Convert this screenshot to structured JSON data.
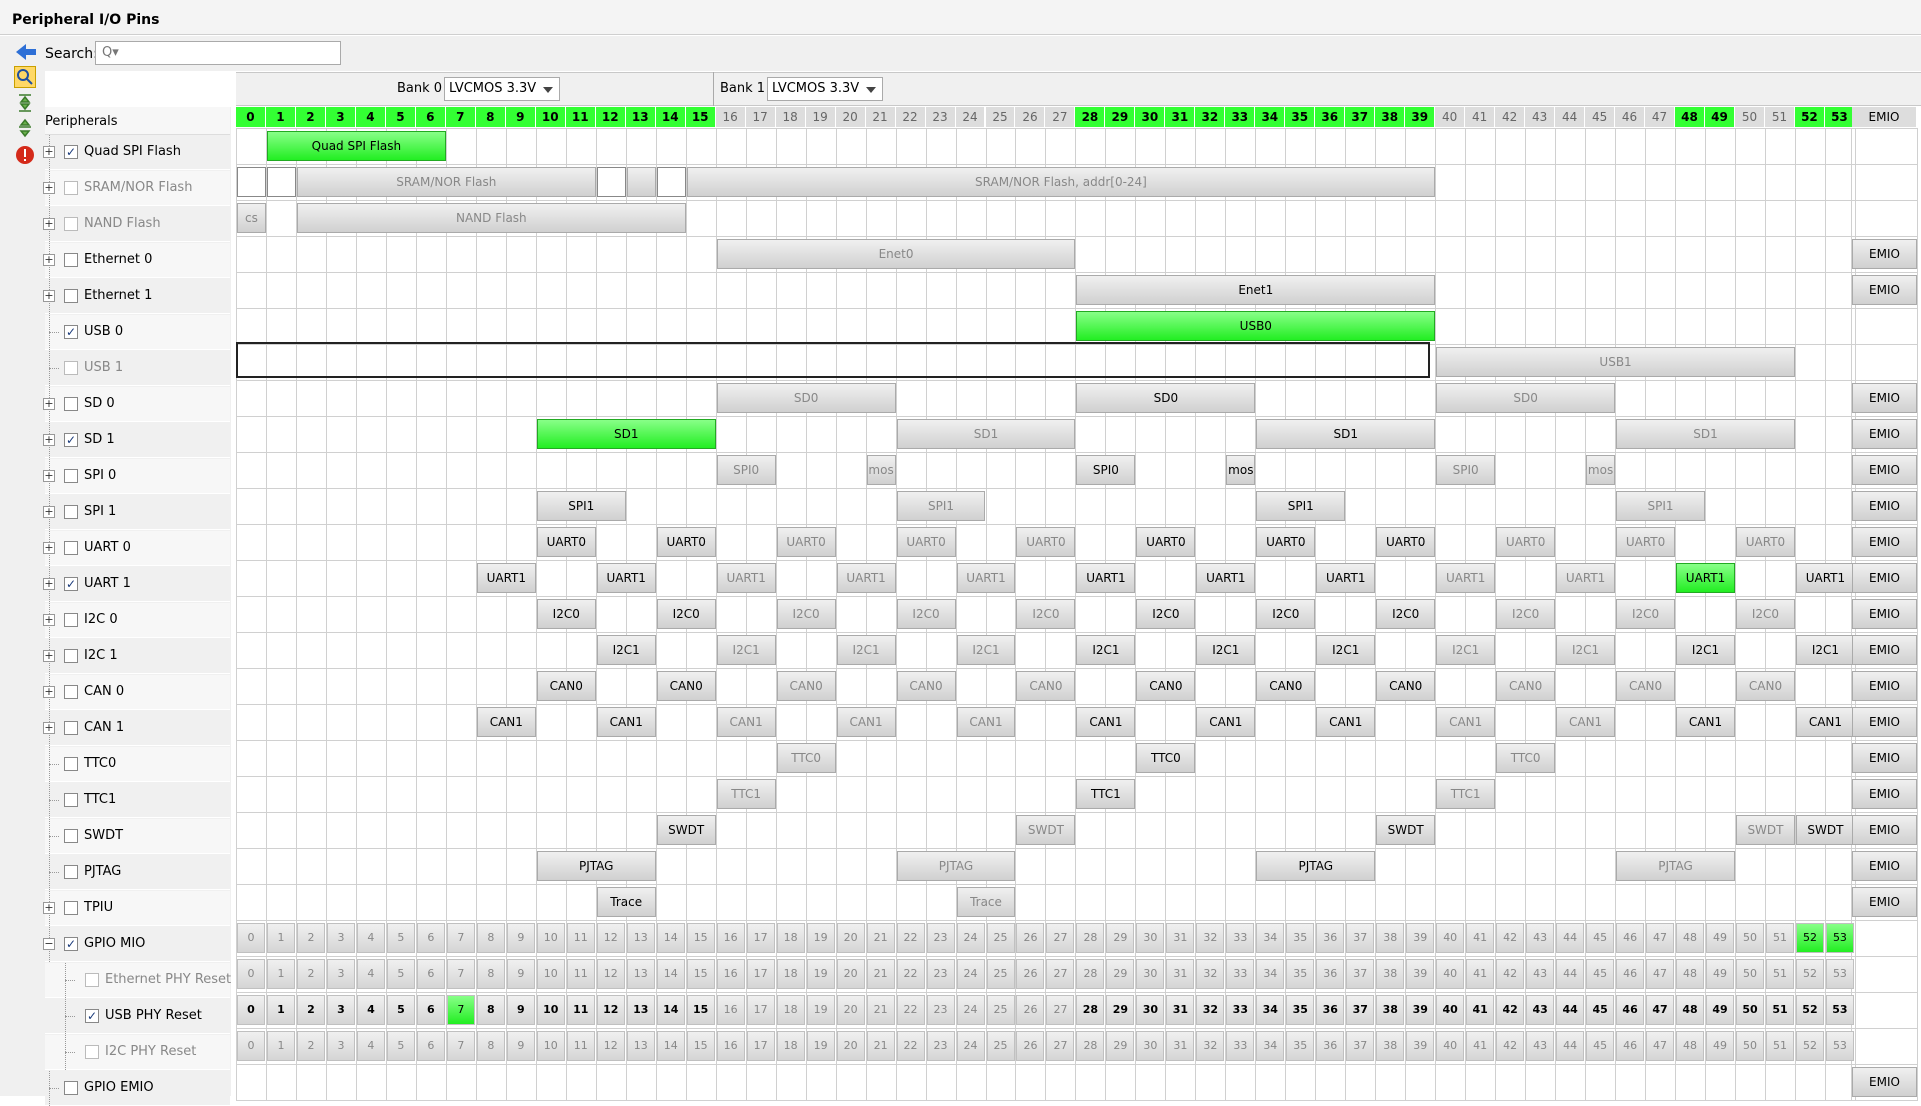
{
  "window": {
    "title": "Peripheral I/O Pins"
  },
  "search": {
    "label": "Search:",
    "placeholder": "Q▾"
  },
  "left_panel": {
    "header": "Peripherals",
    "items": [
      {
        "label": "Quad SPI Flash",
        "checked": true,
        "enabled": true,
        "expandable": true
      },
      {
        "label": "SRAM/NOR Flash",
        "checked": false,
        "enabled": false,
        "expandable": true
      },
      {
        "label": "NAND Flash",
        "checked": false,
        "enabled": false,
        "expandable": true
      },
      {
        "label": "Ethernet 0",
        "checked": false,
        "enabled": true,
        "expandable": true
      },
      {
        "label": "Ethernet 1",
        "checked": false,
        "enabled": true,
        "expandable": true
      },
      {
        "label": "USB 0",
        "checked": true,
        "enabled": true,
        "expandable": false
      },
      {
        "label": "USB 1",
        "checked": false,
        "enabled": false,
        "expandable": false
      },
      {
        "label": "SD 0",
        "checked": false,
        "enabled": true,
        "expandable": true
      },
      {
        "label": "SD 1",
        "checked": true,
        "enabled": true,
        "expandable": true
      },
      {
        "label": "SPI 0",
        "checked": false,
        "enabled": true,
        "expandable": true
      },
      {
        "label": "SPI 1",
        "checked": false,
        "enabled": true,
        "expandable": true
      },
      {
        "label": "UART 0",
        "checked": false,
        "enabled": true,
        "expandable": true
      },
      {
        "label": "UART 1",
        "checked": true,
        "enabled": true,
        "expandable": true
      },
      {
        "label": "I2C 0",
        "checked": false,
        "enabled": true,
        "expandable": true
      },
      {
        "label": "I2C 1",
        "checked": false,
        "enabled": true,
        "expandable": true
      },
      {
        "label": "CAN 0",
        "checked": false,
        "enabled": true,
        "expandable": true
      },
      {
        "label": "CAN 1",
        "checked": false,
        "enabled": true,
        "expandable": true
      },
      {
        "label": "TTC0",
        "checked": false,
        "enabled": true,
        "expandable": false
      },
      {
        "label": "TTC1",
        "checked": false,
        "enabled": true,
        "expandable": false
      },
      {
        "label": "SWDT",
        "checked": false,
        "enabled": true,
        "expandable": false
      },
      {
        "label": "PJTAG",
        "checked": false,
        "enabled": true,
        "expandable": false
      },
      {
        "label": "TPIU",
        "checked": false,
        "enabled": true,
        "expandable": true
      },
      {
        "label": "GPIO MIO",
        "checked": true,
        "enabled": true,
        "expandable": true,
        "expanded": true
      },
      {
        "label": "Ethernet PHY Reset",
        "checked": false,
        "enabled": false,
        "child": true
      },
      {
        "label": "USB PHY Reset",
        "checked": true,
        "enabled": true,
        "child": true
      },
      {
        "label": "I2C PHY Reset",
        "checked": false,
        "enabled": false,
        "child": true
      },
      {
        "label": "GPIO EMIO",
        "checked": false,
        "enabled": true,
        "expandable": false
      }
    ]
  },
  "banks": [
    {
      "label": "Bank 0",
      "voltage": "LVCMOS 3.3V"
    },
    {
      "label": "Bank 1",
      "voltage": "LVCMOS 3.3V"
    }
  ],
  "pins_header": {
    "green": [
      0,
      1,
      2,
      3,
      4,
      5,
      6,
      7,
      8,
      9,
      10,
      11,
      12,
      13,
      14,
      15,
      28,
      29,
      30,
      31,
      32,
      33,
      34,
      35,
      36,
      37,
      38,
      39,
      48,
      49,
      52,
      53
    ],
    "emio_label": "EMIO"
  },
  "rows": [
    {
      "blocks": [
        {
          "label": "Quad SPI Flash",
          "start": 1,
          "span": 6,
          "on": true
        }
      ],
      "emio": false
    },
    {
      "blocks": [
        {
          "label": "",
          "start": 0,
          "span": 1,
          "white": true
        },
        {
          "label": "",
          "start": 1,
          "span": 1,
          "white": true
        },
        {
          "label": "SRAM/NOR Flash",
          "start": 2,
          "span": 10,
          "grey": true
        },
        {
          "label": "",
          "start": 12,
          "span": 1,
          "white": true
        },
        {
          "label": "",
          "start": 13,
          "span": 1,
          "grey": true
        },
        {
          "label": "",
          "start": 14,
          "span": 1,
          "white": true
        },
        {
          "label": "SRAM/NOR Flash, addr[0-24]",
          "start": 15,
          "span": 25,
          "grey": true
        }
      ],
      "emio": false
    },
    {
      "blocks": [
        {
          "label": "cs",
          "start": 0,
          "span": 1,
          "grey": true
        },
        {
          "label": "NAND Flash",
          "start": 2,
          "span": 13,
          "grey": true
        }
      ],
      "emio": false
    },
    {
      "blocks": [
        {
          "label": "Enet0",
          "start": 16,
          "span": 12,
          "grey": true
        }
      ],
      "emio": true
    },
    {
      "blocks": [
        {
          "label": "Enet1",
          "start": 28,
          "span": 12
        }
      ],
      "emio": true
    },
    {
      "blocks": [
        {
          "label": "USB0",
          "start": 28,
          "span": 12,
          "on": true
        }
      ],
      "emio": false
    },
    {
      "blocks": [
        {
          "label": "USB1",
          "start": 40,
          "span": 12,
          "grey": true
        }
      ],
      "emio": false
    },
    {
      "blocks": [
        {
          "label": "SD0",
          "start": 16,
          "span": 6,
          "grey": true
        },
        {
          "label": "SD0",
          "start": 28,
          "span": 6
        },
        {
          "label": "SD0",
          "start": 40,
          "span": 6,
          "grey": true
        }
      ],
      "emio": true
    },
    {
      "blocks": [
        {
          "label": "SD1",
          "start": 10,
          "span": 6,
          "on": true
        },
        {
          "label": "SD1",
          "start": 22,
          "span": 6,
          "grey": true
        },
        {
          "label": "SD1",
          "start": 34,
          "span": 6
        },
        {
          "label": "SD1",
          "start": 46,
          "span": 6,
          "grey": true
        }
      ],
      "emio": true
    },
    {
      "blocks": [
        {
          "label": "SPI0",
          "start": 16,
          "span": 2,
          "grey": true
        },
        {
          "label": "mos",
          "start": 21,
          "span": 1,
          "grey": true
        },
        {
          "label": "SPI0",
          "start": 28,
          "span": 2
        },
        {
          "label": "mos",
          "start": 33,
          "span": 1
        },
        {
          "label": "SPI0",
          "start": 40,
          "span": 2,
          "grey": true
        },
        {
          "label": "mos",
          "start": 45,
          "span": 1,
          "grey": true
        }
      ],
      "emio": true
    },
    {
      "blocks": [
        {
          "label": "SPI1",
          "start": 10,
          "span": 3
        },
        {
          "label": "SPI1",
          "start": 22,
          "span": 3,
          "grey": true
        },
        {
          "label": "SPI1",
          "start": 34,
          "span": 3
        },
        {
          "label": "SPI1",
          "start": 46,
          "span": 3,
          "grey": true
        }
      ],
      "emio": true
    },
    {
      "blocks": [
        {
          "label": "UART0",
          "start": 10,
          "span": 2
        },
        {
          "label": "UART0",
          "start": 14,
          "span": 2
        },
        {
          "label": "UART0",
          "start": 18,
          "span": 2,
          "grey": true
        },
        {
          "label": "UART0",
          "start": 22,
          "span": 2,
          "grey": true
        },
        {
          "label": "UART0",
          "start": 26,
          "span": 2,
          "grey": true
        },
        {
          "label": "UART0",
          "start": 30,
          "span": 2
        },
        {
          "label": "UART0",
          "start": 34,
          "span": 2
        },
        {
          "label": "UART0",
          "start": 38,
          "span": 2
        },
        {
          "label": "UART0",
          "start": 42,
          "span": 2,
          "grey": true
        },
        {
          "label": "UART0",
          "start": 46,
          "span": 2,
          "grey": true
        },
        {
          "label": "UART0",
          "start": 50,
          "span": 2,
          "grey": true
        }
      ],
      "emio": true
    },
    {
      "blocks": [
        {
          "label": "UART1",
          "start": 8,
          "span": 2
        },
        {
          "label": "UART1",
          "start": 12,
          "span": 2
        },
        {
          "label": "UART1",
          "start": 16,
          "span": 2,
          "grey": true
        },
        {
          "label": "UART1",
          "start": 20,
          "span": 2,
          "grey": true
        },
        {
          "label": "UART1",
          "start": 24,
          "span": 2,
          "grey": true
        },
        {
          "label": "UART1",
          "start": 28,
          "span": 2
        },
        {
          "label": "UART1",
          "start": 32,
          "span": 2
        },
        {
          "label": "UART1",
          "start": 36,
          "span": 2
        },
        {
          "label": "UART1",
          "start": 40,
          "span": 2,
          "grey": true
        },
        {
          "label": "UART1",
          "start": 44,
          "span": 2,
          "grey": true
        },
        {
          "label": "UART1",
          "start": 48,
          "span": 2,
          "on": true
        },
        {
          "label": "UART1",
          "start": 52,
          "span": 2
        }
      ],
      "emio": true
    },
    {
      "blocks": [
        {
          "label": "I2C0",
          "start": 10,
          "span": 2
        },
        {
          "label": "I2C0",
          "start": 14,
          "span": 2
        },
        {
          "label": "I2C0",
          "start": 18,
          "span": 2,
          "grey": true
        },
        {
          "label": "I2C0",
          "start": 22,
          "span": 2,
          "grey": true
        },
        {
          "label": "I2C0",
          "start": 26,
          "span": 2,
          "grey": true
        },
        {
          "label": "I2C0",
          "start": 30,
          "span": 2
        },
        {
          "label": "I2C0",
          "start": 34,
          "span": 2
        },
        {
          "label": "I2C0",
          "start": 38,
          "span": 2
        },
        {
          "label": "I2C0",
          "start": 42,
          "span": 2,
          "grey": true
        },
        {
          "label": "I2C0",
          "start": 46,
          "span": 2,
          "grey": true
        },
        {
          "label": "I2C0",
          "start": 50,
          "span": 2,
          "grey": true
        }
      ],
      "emio": true
    },
    {
      "blocks": [
        {
          "label": "I2C1",
          "start": 12,
          "span": 2
        },
        {
          "label": "I2C1",
          "start": 16,
          "span": 2,
          "grey": true
        },
        {
          "label": "I2C1",
          "start": 20,
          "span": 2,
          "grey": true
        },
        {
          "label": "I2C1",
          "start": 24,
          "span": 2,
          "grey": true
        },
        {
          "label": "I2C1",
          "start": 28,
          "span": 2
        },
        {
          "label": "I2C1",
          "start": 32,
          "span": 2
        },
        {
          "label": "I2C1",
          "start": 36,
          "span": 2
        },
        {
          "label": "I2C1",
          "start": 40,
          "span": 2,
          "grey": true
        },
        {
          "label": "I2C1",
          "start": 44,
          "span": 2,
          "grey": true
        },
        {
          "label": "I2C1",
          "start": 48,
          "span": 2
        },
        {
          "label": "I2C1",
          "start": 52,
          "span": 2
        }
      ],
      "emio": true
    },
    {
      "blocks": [
        {
          "label": "CAN0",
          "start": 10,
          "span": 2
        },
        {
          "label": "CAN0",
          "start": 14,
          "span": 2
        },
        {
          "label": "CAN0",
          "start": 18,
          "span": 2,
          "grey": true
        },
        {
          "label": "CAN0",
          "start": 22,
          "span": 2,
          "grey": true
        },
        {
          "label": "CAN0",
          "start": 26,
          "span": 2,
          "grey": true
        },
        {
          "label": "CAN0",
          "start": 30,
          "span": 2
        },
        {
          "label": "CAN0",
          "start": 34,
          "span": 2
        },
        {
          "label": "CAN0",
          "start": 38,
          "span": 2
        },
        {
          "label": "CAN0",
          "start": 42,
          "span": 2,
          "grey": true
        },
        {
          "label": "CAN0",
          "start": 46,
          "span": 2,
          "grey": true
        },
        {
          "label": "CAN0",
          "start": 50,
          "span": 2,
          "grey": true
        }
      ],
      "emio": true
    },
    {
      "blocks": [
        {
          "label": "CAN1",
          "start": 8,
          "span": 2
        },
        {
          "label": "CAN1",
          "start": 12,
          "span": 2
        },
        {
          "label": "CAN1",
          "start": 16,
          "span": 2,
          "grey": true
        },
        {
          "label": "CAN1",
          "start": 20,
          "span": 2,
          "grey": true
        },
        {
          "label": "CAN1",
          "start": 24,
          "span": 2,
          "grey": true
        },
        {
          "label": "CAN1",
          "start": 28,
          "span": 2
        },
        {
          "label": "CAN1",
          "start": 32,
          "span": 2
        },
        {
          "label": "CAN1",
          "start": 36,
          "span": 2
        },
        {
          "label": "CAN1",
          "start": 40,
          "span": 2,
          "grey": true
        },
        {
          "label": "CAN1",
          "start": 44,
          "span": 2,
          "grey": true
        },
        {
          "label": "CAN1",
          "start": 48,
          "span": 2
        },
        {
          "label": "CAN1",
          "start": 52,
          "span": 2
        }
      ],
      "emio": true
    },
    {
      "blocks": [
        {
          "label": "TTC0",
          "start": 18,
          "span": 2,
          "grey": true
        },
        {
          "label": "TTC0",
          "start": 30,
          "span": 2
        },
        {
          "label": "TTC0",
          "start": 42,
          "span": 2,
          "grey": true
        }
      ],
      "emio": true
    },
    {
      "blocks": [
        {
          "label": "TTC1",
          "start": 16,
          "span": 2,
          "grey": true
        },
        {
          "label": "TTC1",
          "start": 28,
          "span": 2
        },
        {
          "label": "TTC1",
          "start": 40,
          "span": 2,
          "grey": true
        }
      ],
      "emio": true
    },
    {
      "blocks": [
        {
          "label": "SWDT",
          "start": 14,
          "span": 2
        },
        {
          "label": "SWDT",
          "start": 26,
          "span": 2,
          "grey": true
        },
        {
          "label": "SWDT",
          "start": 38,
          "span": 2
        },
        {
          "label": "SWDT",
          "start": 50,
          "span": 2,
          "grey": true
        },
        {
          "label": "SWDT",
          "start": 52,
          "span": 2
        }
      ],
      "emio": true
    },
    {
      "blocks": [
        {
          "label": "PJTAG",
          "start": 10,
          "span": 4
        },
        {
          "label": "PJTAG",
          "start": 22,
          "span": 4,
          "grey": true
        },
        {
          "label": "PJTAG",
          "start": 34,
          "span": 4
        },
        {
          "label": "PJTAG",
          "start": 46,
          "span": 4,
          "grey": true
        }
      ],
      "emio": true
    },
    {
      "blocks": [
        {
          "label": "Trace",
          "start": 12,
          "span": 2
        },
        {
          "label": "Trace",
          "start": 24,
          "span": 2,
          "grey": true
        }
      ],
      "emio": true
    }
  ],
  "gpio_rows": [
    {
      "bold": [],
      "on": [
        52,
        53
      ]
    },
    {
      "bold": [],
      "on": []
    },
    {
      "bold": [
        0,
        1,
        2,
        3,
        4,
        5,
        6,
        8,
        9,
        10,
        11,
        12,
        13,
        14,
        15,
        28,
        29,
        30,
        31,
        32,
        33,
        34,
        35,
        36,
        37,
        38,
        39,
        40,
        41,
        42,
        43,
        44,
        45,
        46,
        47,
        48,
        49,
        50,
        51,
        52,
        53
      ],
      "on": [
        7
      ]
    },
    {
      "bold": [],
      "on": []
    }
  ],
  "gpio_emio_label": "EMIO"
}
